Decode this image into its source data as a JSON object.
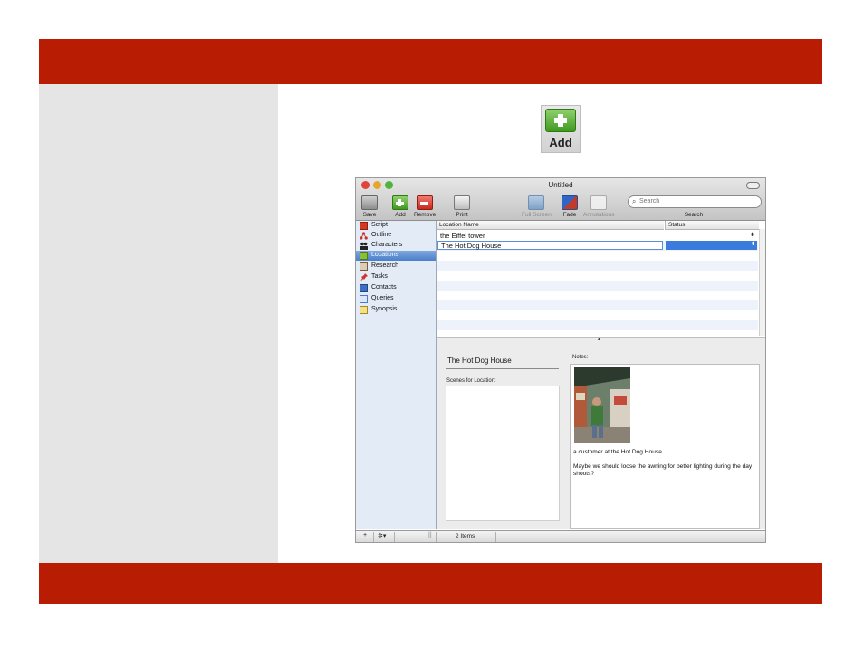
{
  "slide": {
    "accent_color": "#b81c02",
    "panel_color": "#e5e5e5"
  },
  "add_button_large": {
    "label": "Add",
    "icon": "plus-icon"
  },
  "window": {
    "title": "Untitled",
    "toolbar": {
      "save": "Save",
      "add": "Add",
      "remove": "Remove",
      "print": "Print",
      "full_screen": "Full Screen",
      "fade": "Fade",
      "annotations": "Annotations",
      "search_placeholder": "Search",
      "search_label": "Search"
    },
    "sidebar": {
      "items": [
        {
          "label": "Script",
          "icon": "script-icon",
          "color": "#d33a22"
        },
        {
          "label": "Outline",
          "icon": "outline-icon",
          "color": "#c8342b"
        },
        {
          "label": "Characters",
          "icon": "characters-icon",
          "color": "#222222"
        },
        {
          "label": "Locations",
          "icon": "locations-icon",
          "color": "#8bbf3a"
        },
        {
          "label": "Research",
          "icon": "research-icon",
          "color": "#7a5a3a"
        },
        {
          "label": "Tasks",
          "icon": "pushpin-icon",
          "color": "#d3302a"
        },
        {
          "label": "Contacts",
          "icon": "contacts-icon",
          "color": "#3a6fc4"
        },
        {
          "label": "Queries",
          "icon": "queries-icon",
          "color": "#4a7ad4"
        },
        {
          "label": "Synopsis",
          "icon": "synopsis-icon",
          "color": "#d8b32a"
        }
      ],
      "selected": "Locations"
    },
    "table": {
      "columns": [
        "Location Name",
        "Status"
      ],
      "rows": [
        {
          "name": "the Eiffel tower",
          "status": ""
        },
        {
          "name": "The Hot Dog House",
          "status": ""
        }
      ]
    },
    "detail": {
      "location_title": "The Hot Dog House",
      "scenes_label": "Scenes for Location:",
      "notes_label": "Notes:",
      "notes_caption": "a customer at the Hot Dog House.",
      "notes_body": "Maybe we should loose the awning for better lighting during the day shoots?"
    },
    "bottom_bar": {
      "add_symbol": "+",
      "gear_symbol": "✲▾",
      "count": "2 Items"
    }
  }
}
